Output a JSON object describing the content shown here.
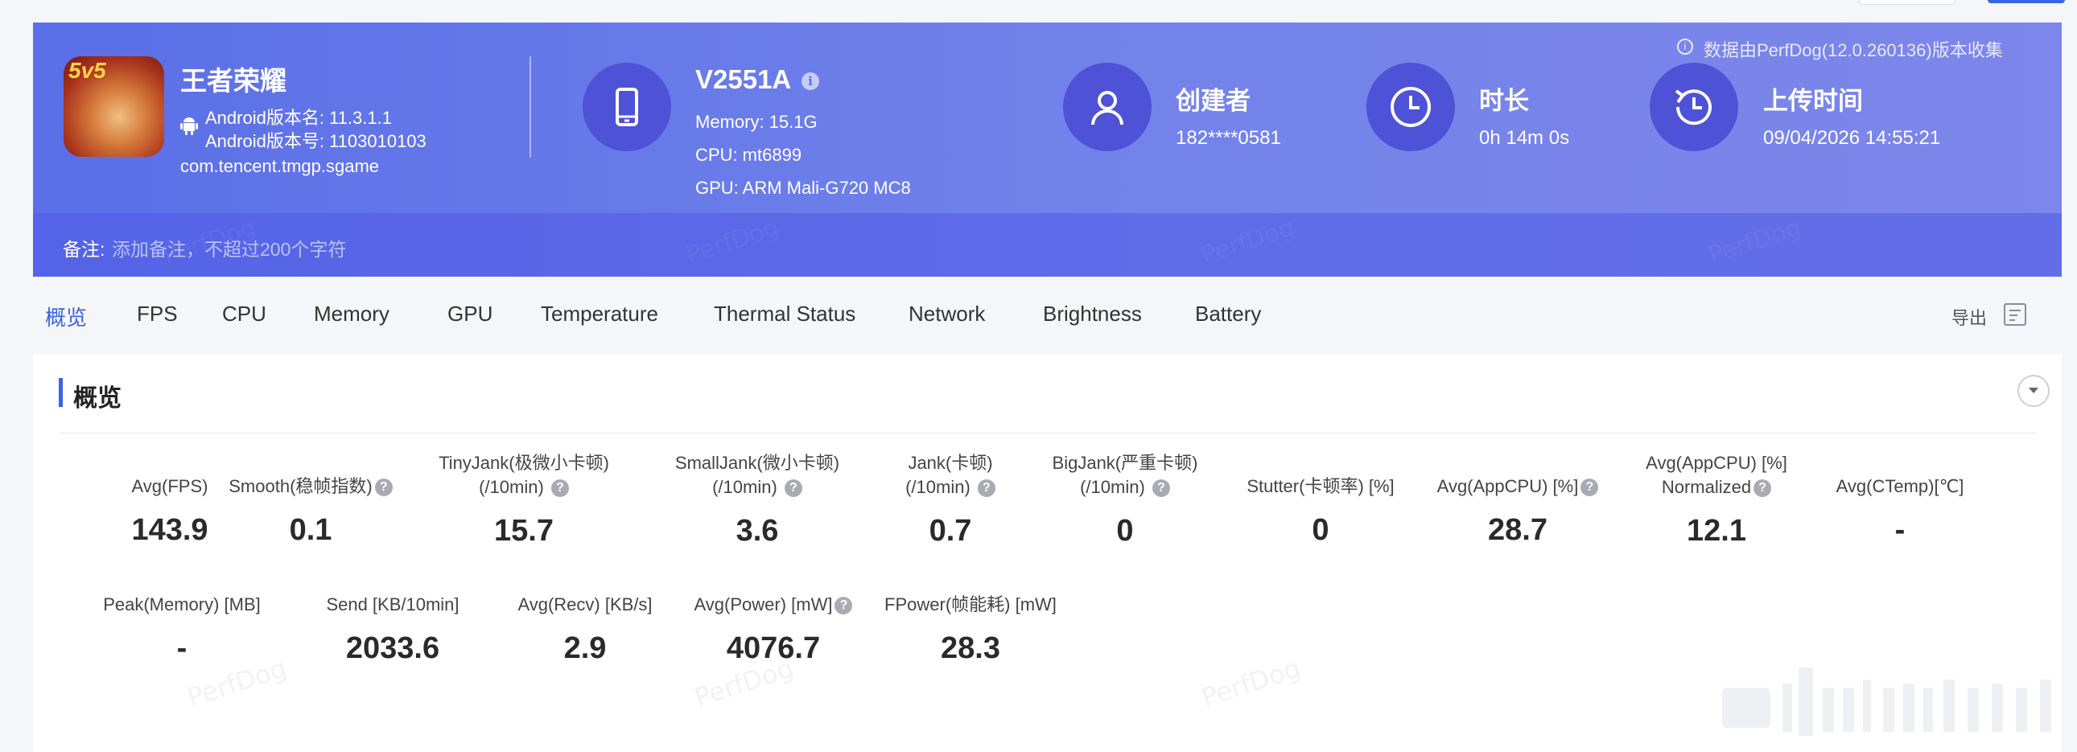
{
  "app": {
    "name": "王者荣耀",
    "icon_badge": "5v5",
    "android_version_name": "Android版本名: 11.3.1.1",
    "android_version_code": "Android版本号: 1103010103",
    "package": "com.tencent.tmgp.sgame"
  },
  "device": {
    "model": "V2551A",
    "info_icon": "i",
    "memory": "Memory: 15.1G",
    "cpu": "CPU: mt6899",
    "gpu": "GPU: ARM Mali-G720 MC8"
  },
  "creator": {
    "title": "创建者",
    "value": "182****0581"
  },
  "duration": {
    "title": "时长",
    "value": "0h 14m 0s"
  },
  "upload": {
    "title": "上传时间",
    "value": "09/04/2026 14:55:21"
  },
  "collect_note": "数据由PerfDog(12.0.260136)版本收集",
  "collect_icon": "i",
  "remark": {
    "label": "备注:",
    "placeholder": "添加备注，不超过200个字符"
  },
  "watermark": "PerfDog",
  "tabs": [
    {
      "label": "概览"
    },
    {
      "label": "FPS"
    },
    {
      "label": "CPU"
    },
    {
      "label": "Memory"
    },
    {
      "label": "GPU"
    },
    {
      "label": "Temperature"
    },
    {
      "label": "Thermal Status"
    },
    {
      "label": "Network"
    },
    {
      "label": "Brightness"
    },
    {
      "label": "Battery"
    }
  ],
  "export_label": "导出",
  "overview": {
    "title": "概览",
    "metrics_row1": [
      {
        "label": "Avg(FPS)",
        "value": "143.9"
      },
      {
        "label": "Smooth(稳帧指数)",
        "value": "0.1"
      },
      {
        "label1": "TinyJank(极微小卡顿)",
        "label2": "(/10min)",
        "value": "15.7"
      },
      {
        "label1": "SmallJank(微小卡顿)",
        "label2": "(/10min)",
        "value": "3.6"
      },
      {
        "label1": "Jank(卡顿)",
        "label2": "(/10min)",
        "value": "0.7"
      },
      {
        "label1": "BigJank(严重卡顿)",
        "label2": "(/10min)",
        "value": "0"
      },
      {
        "label": "Stutter(卡顿率) [%]",
        "value": "0"
      },
      {
        "label": "Avg(AppCPU) [%]",
        "value": "28.7"
      },
      {
        "label1": "Avg(AppCPU) [%]",
        "label2": "Normalized",
        "value": "12.1"
      },
      {
        "label": "Avg(CTemp)[℃]",
        "value": "-"
      }
    ],
    "metrics_row2": [
      {
        "label": "Peak(Memory) [MB]",
        "value": "-"
      },
      {
        "label": "Send [KB/10min]",
        "value": "2033.6"
      },
      {
        "label": "Avg(Recv) [KB/s]",
        "value": "2.9"
      },
      {
        "label": "Avg(Power) [mW]",
        "value": "4076.7"
      },
      {
        "label": "FPower(帧能耗) [mW]",
        "value": "28.3"
      }
    ],
    "help_glyph": "?"
  }
}
